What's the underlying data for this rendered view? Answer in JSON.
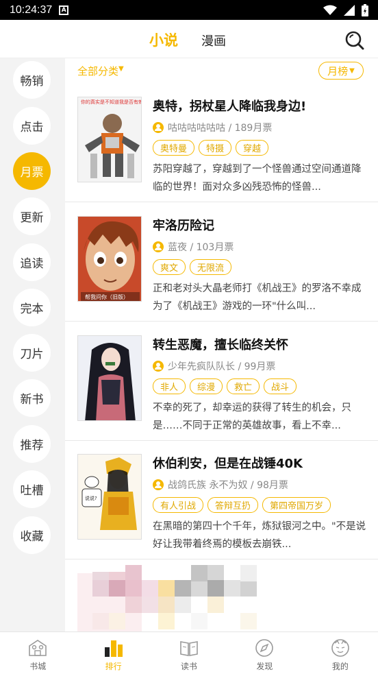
{
  "status": {
    "time": "10:24:37"
  },
  "header": {
    "tabs": [
      "小说",
      "漫画"
    ]
  },
  "sidebar": {
    "items": [
      "畅销",
      "点击",
      "月票",
      "更新",
      "追读",
      "完本",
      "刀片",
      "新书",
      "推荐",
      "吐槽",
      "收藏"
    ],
    "active": "月票"
  },
  "filter": {
    "category": "全部分类",
    "ranking": "月榜"
  },
  "books": [
    {
      "title": "奥特，拐杖星人降临我身边!",
      "author": "咕咕咕咕咕咕 / 189月票",
      "tags": [
        "奥特曼",
        "特摄",
        "穿越"
      ],
      "desc": "苏阳穿越了，穿越到了一个怪兽通过空间通道降临的世界！面对众多凶残恐怖的怪兽...",
      "cover_text": "你的真实是不知道我是否有刺客?"
    },
    {
      "title": "牢洛历险记",
      "author": "蓝夜 / 103月票",
      "tags": [
        "爽文",
        "无限流"
      ],
      "desc": "正和老对头大晶老师打《机战王》的罗洛不幸成为了《机战王》游戏的一环\"什么叫...",
      "cover_text": "帮我问你（旧版）"
    },
    {
      "title": "转生恶魔，擅长临终关怀",
      "author": "少年先疯队队长 / 99月票",
      "tags": [
        "非人",
        "综漫",
        "救亡",
        "战斗"
      ],
      "desc": "不幸的死了，却幸运的获得了转生的机会，只是……不同于正常的英雄故事，看上不幸...",
      "cover_text": ""
    },
    {
      "title": "休伯利安，但是在战锤40K",
      "author": "战鸽氏族 永不为奴 / 98月票",
      "tags": [
        "有人引战",
        "答辩互扔",
        "第四帝国万岁"
      ],
      "desc": "在黑暗的第四十个千年，炼狱银河之中。\"不是说好让我带着终焉的模板去崩铁...",
      "cover_text": "说说?"
    }
  ],
  "bottom_nav": {
    "items": [
      "书城",
      "排行",
      "读书",
      "发现",
      "我的"
    ],
    "active": "排行"
  },
  "colors": {
    "accent": "#f5b800"
  }
}
